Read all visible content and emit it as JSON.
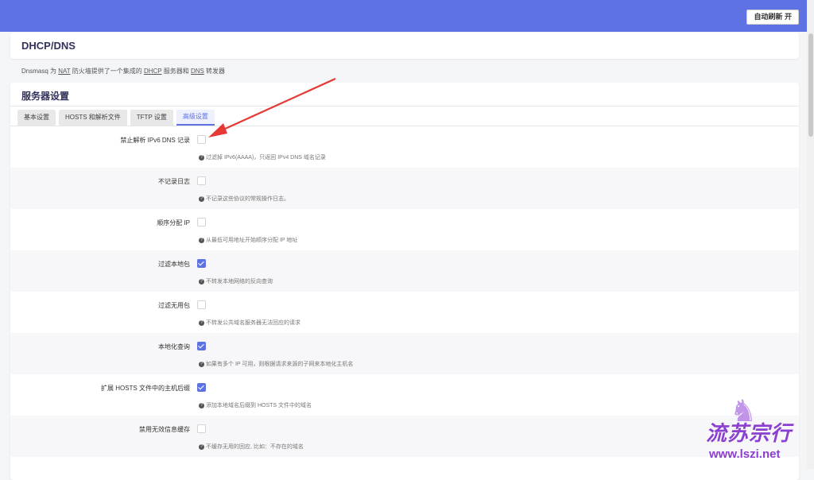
{
  "topbar": {
    "refresh_label": "自动刷新 开"
  },
  "title": "DHCP/DNS",
  "description": {
    "p1": "Dnsmasq 为 ",
    "nat": "NAT",
    "p2": " 防火墙提供了一个集成的 ",
    "dhcp": "DHCP",
    "p3": " 服务器和 ",
    "dns": "DNS",
    "p4": " 转发器"
  },
  "section_title": "服务器设置",
  "tabs": [
    "基本设置",
    "HOSTS 和解析文件",
    "TFTP 设置",
    "高级设置"
  ],
  "active_tab": 3,
  "rows": [
    {
      "label": "禁止解析 IPv6 DNS 记录",
      "checked": false,
      "hint": "过滤掉 IPv6(AAAA)，只返回 IPv4 DNS 域名记录"
    },
    {
      "label": "不记录日志",
      "checked": false,
      "hint": "不记录这些协议的常规操作日志。"
    },
    {
      "label": "顺序分配 IP",
      "checked": false,
      "hint": "从最低可用地址开始顺序分配 IP 地址"
    },
    {
      "label": "过滤本地包",
      "checked": true,
      "hint": "不转发本地网络的反向查询"
    },
    {
      "label": "过滤无用包",
      "checked": false,
      "hint": "不转发公共域名服务器无法回应的请求"
    },
    {
      "label": "本地化查询",
      "checked": true,
      "hint": "如果有多个 IP 可用，则根据请求来源的子网来本地化主机名"
    },
    {
      "label": "扩展 HOSTS 文件中的主机后缀",
      "checked": true,
      "hint": "添加本地域名后缀到 HOSTS 文件中的域名"
    },
    {
      "label": "禁用无效信息缓存",
      "checked": false,
      "hint": "不缓存无用的回应, 比如：不存在的域名"
    }
  ],
  "watermark": {
    "logo": "流苏宗行",
    "url": "www.lszi.net"
  }
}
